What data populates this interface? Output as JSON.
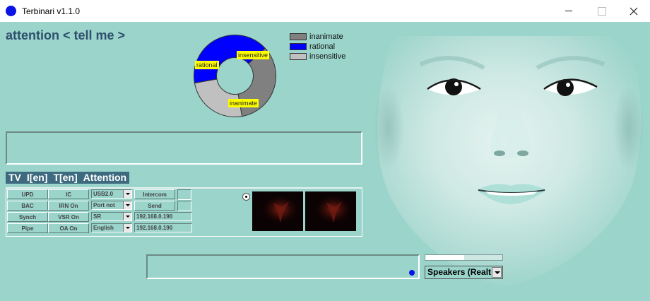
{
  "window": {
    "title": "Terbinari v1.1.0"
  },
  "heading": "attention < tell me >",
  "chart_data": {
    "type": "pie",
    "categories": [
      "inanimate",
      "rational",
      "insensitive"
    ],
    "values": [
      34,
      41,
      25
    ],
    "colors": [
      "#808080",
      "#0000ff",
      "#c0c0c0"
    ],
    "legend": [
      "inanimate",
      "rational",
      "insensitive"
    ],
    "legend_position": "right",
    "title": ""
  },
  "tabs": [
    "TV",
    "I[en]",
    "T[en]",
    "Attention"
  ],
  "panel": {
    "col1": [
      "UPD",
      "BAC",
      "Synch",
      "Pipe"
    ],
    "col2": [
      "IC",
      "IRN On",
      "VSR On",
      "OA On"
    ],
    "selects": [
      "USB2.0",
      "Port not",
      "SR",
      "English"
    ],
    "intercom": "Intercom",
    "send": "Send",
    "ip1": "192.168.0.190",
    "ip2": "192.168.0.190"
  },
  "progress": {
    "value_fraction": 0.5
  },
  "audio_device": "Speakers (Realt",
  "colors": {
    "background": "#9ad4cb",
    "accent": "#0a12e6",
    "tab_bg": "#3d6a7e"
  },
  "icons": [
    "app-icon",
    "minimize-icon",
    "maximize-icon",
    "close-icon",
    "chevron-down-icon"
  ]
}
